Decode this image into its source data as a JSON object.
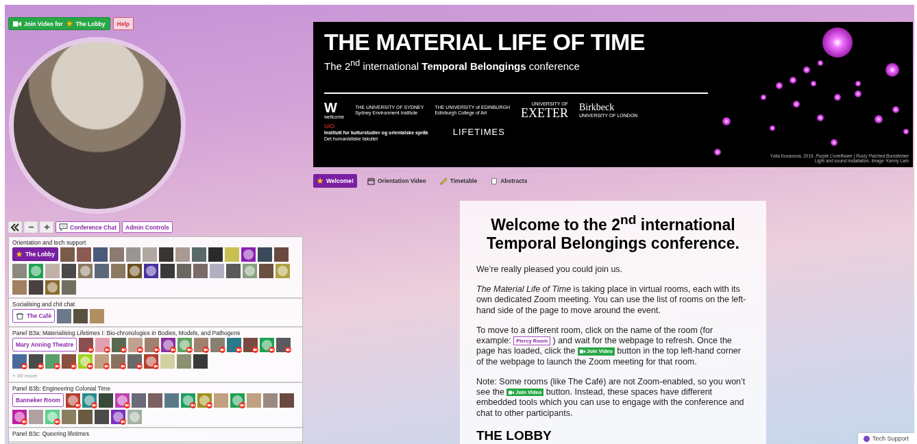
{
  "join_button": {
    "label": "Join Video for",
    "room": "The Lobby"
  },
  "help_button": "Help",
  "room_controls": {
    "chat": "Conference Chat",
    "admin": "Admin Controls"
  },
  "sections": [
    {
      "title": "Orientation and tech support",
      "room": {
        "name": "The Lobby",
        "kind": "featured",
        "selected": true
      },
      "avatars": [
        {
          "kind": "photo",
          "color": "#7a5a4a",
          "video": false
        },
        {
          "kind": "photo",
          "color": "#8b5a50",
          "video": false
        },
        {
          "kind": "photo",
          "color": "#4a5a7a",
          "video": false
        },
        {
          "kind": "photo",
          "color": "#8a7a70",
          "video": false
        },
        {
          "kind": "photo",
          "color": "#9a9590",
          "video": false
        },
        {
          "kind": "photo",
          "color": "#b0a8a0",
          "video": false
        },
        {
          "kind": "photo",
          "color": "#3a3533",
          "video": false
        },
        {
          "kind": "photo",
          "color": "#a89a90",
          "video": false
        },
        {
          "kind": "photo",
          "color": "#5a6a6a",
          "video": false
        },
        {
          "kind": "photo",
          "color": "#2a2a2a",
          "video": false
        },
        {
          "kind": "photo",
          "color": "#c8c050",
          "video": false
        },
        {
          "kind": "placeholder",
          "color": "#8a20b0",
          "video": false
        },
        {
          "kind": "photo",
          "color": "#3a4a5a",
          "video": false
        },
        {
          "kind": "photo",
          "color": "#6a4a40",
          "video": false
        },
        {
          "kind": "photo",
          "color": "#8a8a80",
          "video": false
        },
        {
          "kind": "placeholder",
          "color": "#20a050",
          "video": false
        },
        {
          "kind": "photo",
          "color": "#c0b0a8",
          "video": false
        },
        {
          "kind": "photo",
          "color": "#4a4a4a",
          "video": false
        },
        {
          "kind": "placeholder",
          "color": "#8a7a60",
          "video": false
        },
        {
          "kind": "photo",
          "color": "#5a6a7a",
          "video": false
        },
        {
          "kind": "photo",
          "color": "#8a7a60",
          "video": false
        },
        {
          "kind": "placeholder",
          "color": "#6a5020",
          "video": false
        },
        {
          "kind": "placeholder",
          "color": "#4a30a0",
          "video": false
        },
        {
          "kind": "photo",
          "color": "#3a3a3a",
          "video": false
        },
        {
          "kind": "photo",
          "color": "#6a6660",
          "video": false
        },
        {
          "kind": "photo",
          "color": "#7a6a68",
          "video": false
        },
        {
          "kind": "photo",
          "color": "#b0b0c0",
          "video": false
        },
        {
          "kind": "photo",
          "color": "#5a5a5a",
          "video": false
        },
        {
          "kind": "placeholder",
          "color": "#8aa080",
          "video": false
        },
        {
          "kind": "photo",
          "color": "#6a5040",
          "video": false
        },
        {
          "kind": "placeholder",
          "color": "#b0a040",
          "video": false
        },
        {
          "kind": "photo",
          "color": "#a08060",
          "video": false
        },
        {
          "kind": "photo",
          "color": "#4a4040",
          "video": false
        },
        {
          "kind": "placeholder",
          "color": "#8a6a30",
          "video": false
        },
        {
          "kind": "photo",
          "color": "#707060",
          "video": false
        }
      ]
    },
    {
      "title": "Socialising and chit chat",
      "room": {
        "name": "The Café",
        "kind": "social",
        "selected": false
      },
      "avatars": [
        {
          "kind": "photo",
          "color": "#6a7a8a",
          "video": false
        },
        {
          "kind": "photo",
          "color": "#5a5040",
          "video": false
        },
        {
          "kind": "photo",
          "color": "#b09060",
          "video": false
        }
      ]
    },
    {
      "title": "Panel B3a: Materialising Lifetimes I: Bio-chronologies in Bodies, Models, and Pathogens",
      "room": {
        "name": "Mary Anning Theatre",
        "kind": "session",
        "selected": false
      },
      "more": "+ 49 more",
      "avatars": [
        {
          "kind": "photo",
          "color": "#8a5050",
          "video": true
        },
        {
          "kind": "photo",
          "color": "#e0a0b0",
          "video": true
        },
        {
          "kind": "photo",
          "color": "#5a6a50",
          "video": true
        },
        {
          "kind": "photo",
          "color": "#c0a090",
          "video": true
        },
        {
          "kind": "photo",
          "color": "#a08070",
          "video": true
        },
        {
          "kind": "placeholder",
          "color": "#8a30a0",
          "video": true
        },
        {
          "kind": "placeholder",
          "color": "#60a060",
          "video": true
        },
        {
          "kind": "photo",
          "color": "#a08070",
          "video": true
        },
        {
          "kind": "photo",
          "color": "#8a8070",
          "video": true
        },
        {
          "kind": "photo",
          "color": "#2a7a8a",
          "video": true
        },
        {
          "kind": "photo",
          "color": "#7a4a40",
          "video": true
        },
        {
          "kind": "placeholder",
          "color": "#20a050",
          "video": true
        },
        {
          "kind": "photo",
          "color": "#5a5a60",
          "video": true
        },
        {
          "kind": "photo",
          "color": "#4a6a9a",
          "video": true
        },
        {
          "kind": "photo",
          "color": "#4a4a4a",
          "video": true
        },
        {
          "kind": "photo",
          "color": "#5aa06a",
          "video": true
        },
        {
          "kind": "photo",
          "color": "#8a5040",
          "video": true
        },
        {
          "kind": "placeholder",
          "color": "#a0d020",
          "video": true
        },
        {
          "kind": "photo",
          "color": "#c0a080",
          "video": true
        },
        {
          "kind": "photo",
          "color": "#8a7060",
          "video": true
        },
        {
          "kind": "photo",
          "color": "#6a6a6a",
          "video": true
        },
        {
          "kind": "placeholder",
          "color": "#b04030",
          "video": true
        },
        {
          "kind": "photo",
          "color": "#d0d0a0",
          "video": false
        },
        {
          "kind": "photo",
          "color": "#8a9070",
          "video": false
        },
        {
          "kind": "photo",
          "color": "#3a3a3a",
          "video": false
        }
      ]
    },
    {
      "title": "Panel B3b: Engineering Colonial Time",
      "room": {
        "name": "Banneker Room",
        "kind": "session",
        "selected": false
      },
      "avatars": [
        {
          "kind": "placeholder",
          "color": "#b04030",
          "video": true
        },
        {
          "kind": "placeholder",
          "color": "#2a8a8a",
          "video": true
        },
        {
          "kind": "photo",
          "color": "#3a4a3a",
          "video": false
        },
        {
          "kind": "placeholder",
          "color": "#c040b0",
          "video": true
        },
        {
          "kind": "photo",
          "color": "#6a6a7a",
          "video": false
        },
        {
          "kind": "photo",
          "color": "#7a6060",
          "video": false
        },
        {
          "kind": "photo",
          "color": "#5a7a8a",
          "video": false
        },
        {
          "kind": "placeholder",
          "color": "#20a060",
          "video": true
        },
        {
          "kind": "placeholder",
          "color": "#a09020",
          "video": true
        },
        {
          "kind": "photo",
          "color": "#c0a080",
          "video": false
        },
        {
          "kind": "placeholder",
          "color": "#20a050",
          "video": true
        },
        {
          "kind": "photo",
          "color": "#c0a080",
          "video": false
        },
        {
          "kind": "photo",
          "color": "#9a8a80",
          "video": false
        },
        {
          "kind": "photo",
          "color": "#6a4a40",
          "video": false
        },
        {
          "kind": "placeholder",
          "color": "#c020a0",
          "video": true
        },
        {
          "kind": "photo",
          "color": "#b0a0a0",
          "video": false
        },
        {
          "kind": "placeholder",
          "color": "#60d090",
          "video": true
        },
        {
          "kind": "photo",
          "color": "#8a8060",
          "video": false
        },
        {
          "kind": "photo",
          "color": "#6a5a40",
          "video": false
        },
        {
          "kind": "photo",
          "color": "#4a4a4a",
          "video": false
        },
        {
          "kind": "placeholder",
          "color": "#7a30c0",
          "video": true
        },
        {
          "kind": "placeholder",
          "color": "#a0b0a0",
          "video": false
        }
      ]
    },
    {
      "title": "Panel B3c: Queering lifetimes"
    }
  ],
  "banner": {
    "title": "THE MATERIAL LIFE OF TIME",
    "subtitle": "The 2$^{nd}$ international **Temporal Belongings** conference",
    "logos": [
      {
        "kind": "wellcome",
        "lines": [
          "W",
          "wellcome"
        ]
      },
      {
        "kind": "sydney",
        "lines": [
          "THE UNIVERSITY OF SYDNEY",
          "Sydney Environment Institute"
        ]
      },
      {
        "kind": "edinburgh",
        "lines": [
          "THE UNIVERSITY of EDINBURGH",
          "Edinburgh College of Art"
        ]
      },
      {
        "kind": "exeter",
        "lines": [
          "UNIVERSITY OF",
          "EXETER"
        ]
      },
      {
        "kind": "birkbeck",
        "lines": [
          "Birkbeck",
          "UNIVERSITY OF LONDON"
        ]
      }
    ],
    "logos_row2": [
      {
        "kind": "uio",
        "lines": [
          "UiO",
          "Institutt for kulturstudier og orientalske språk",
          "Det humanistiske fakultet"
        ]
      },
      {
        "kind": "lifetimes",
        "lines": [
          "LIFETIMES"
        ]
      }
    ],
    "caption": [
      "Yulia Kovanova, 2019. *Purple Coneflower | Rusty Patched Bumblebee*",
      "Light and sound installation. Image: Kenny Lam"
    ]
  },
  "tabs": [
    {
      "label": "Welcome!",
      "kind": "star",
      "selected": true
    },
    {
      "label": "Orientation Video",
      "kind": "video",
      "selected": false
    },
    {
      "label": "Timetable",
      "kind": "pencil",
      "selected": false
    },
    {
      "label": "Abstracts",
      "kind": "scroll",
      "selected": false
    }
  ],
  "content": {
    "heading": "Welcome to the 2$^{nd}$ international Temporal Belongings conference.",
    "paragraphs": [
      {
        "parts": [
          {
            "kind": "text",
            "text": "We’re really pleased you could join us."
          }
        ]
      },
      {
        "parts": [
          {
            "kind": "text",
            "text": "*The Material Life of Time* is taking place in virtual rooms, each with its own dedicated Zoom meeting. You can use the list of rooms on the left-hand side of the page to move around the event."
          }
        ]
      },
      {
        "parts": [
          {
            "kind": "text",
            "text": "To move to a different room, click on the name of the room (for example: "
          },
          {
            "kind": "room",
            "text": "Piercy Room"
          },
          {
            "kind": "text",
            "text": " ) and wait for the webpage to refresh. Once the page has loaded, click the "
          },
          {
            "kind": "video",
            "text": "Join Video"
          },
          {
            "kind": "text",
            "text": " button in the top left-hand corner of the webpage to launch the Zoom meeting for that room."
          }
        ]
      },
      {
        "parts": [
          {
            "kind": "text",
            "text": "Note: Some rooms (like The Café) are not Zoom-enabled, so you won’t see the "
          },
          {
            "kind": "video",
            "text": "Join Video"
          },
          {
            "kind": "text",
            "text": " button. Instead, these spaces have different embedded tools which you can use to engage with the conference and chat to other participants."
          }
        ]
      }
    ],
    "subheading": "THE LOBBY"
  },
  "tech_support": "Tech Support"
}
